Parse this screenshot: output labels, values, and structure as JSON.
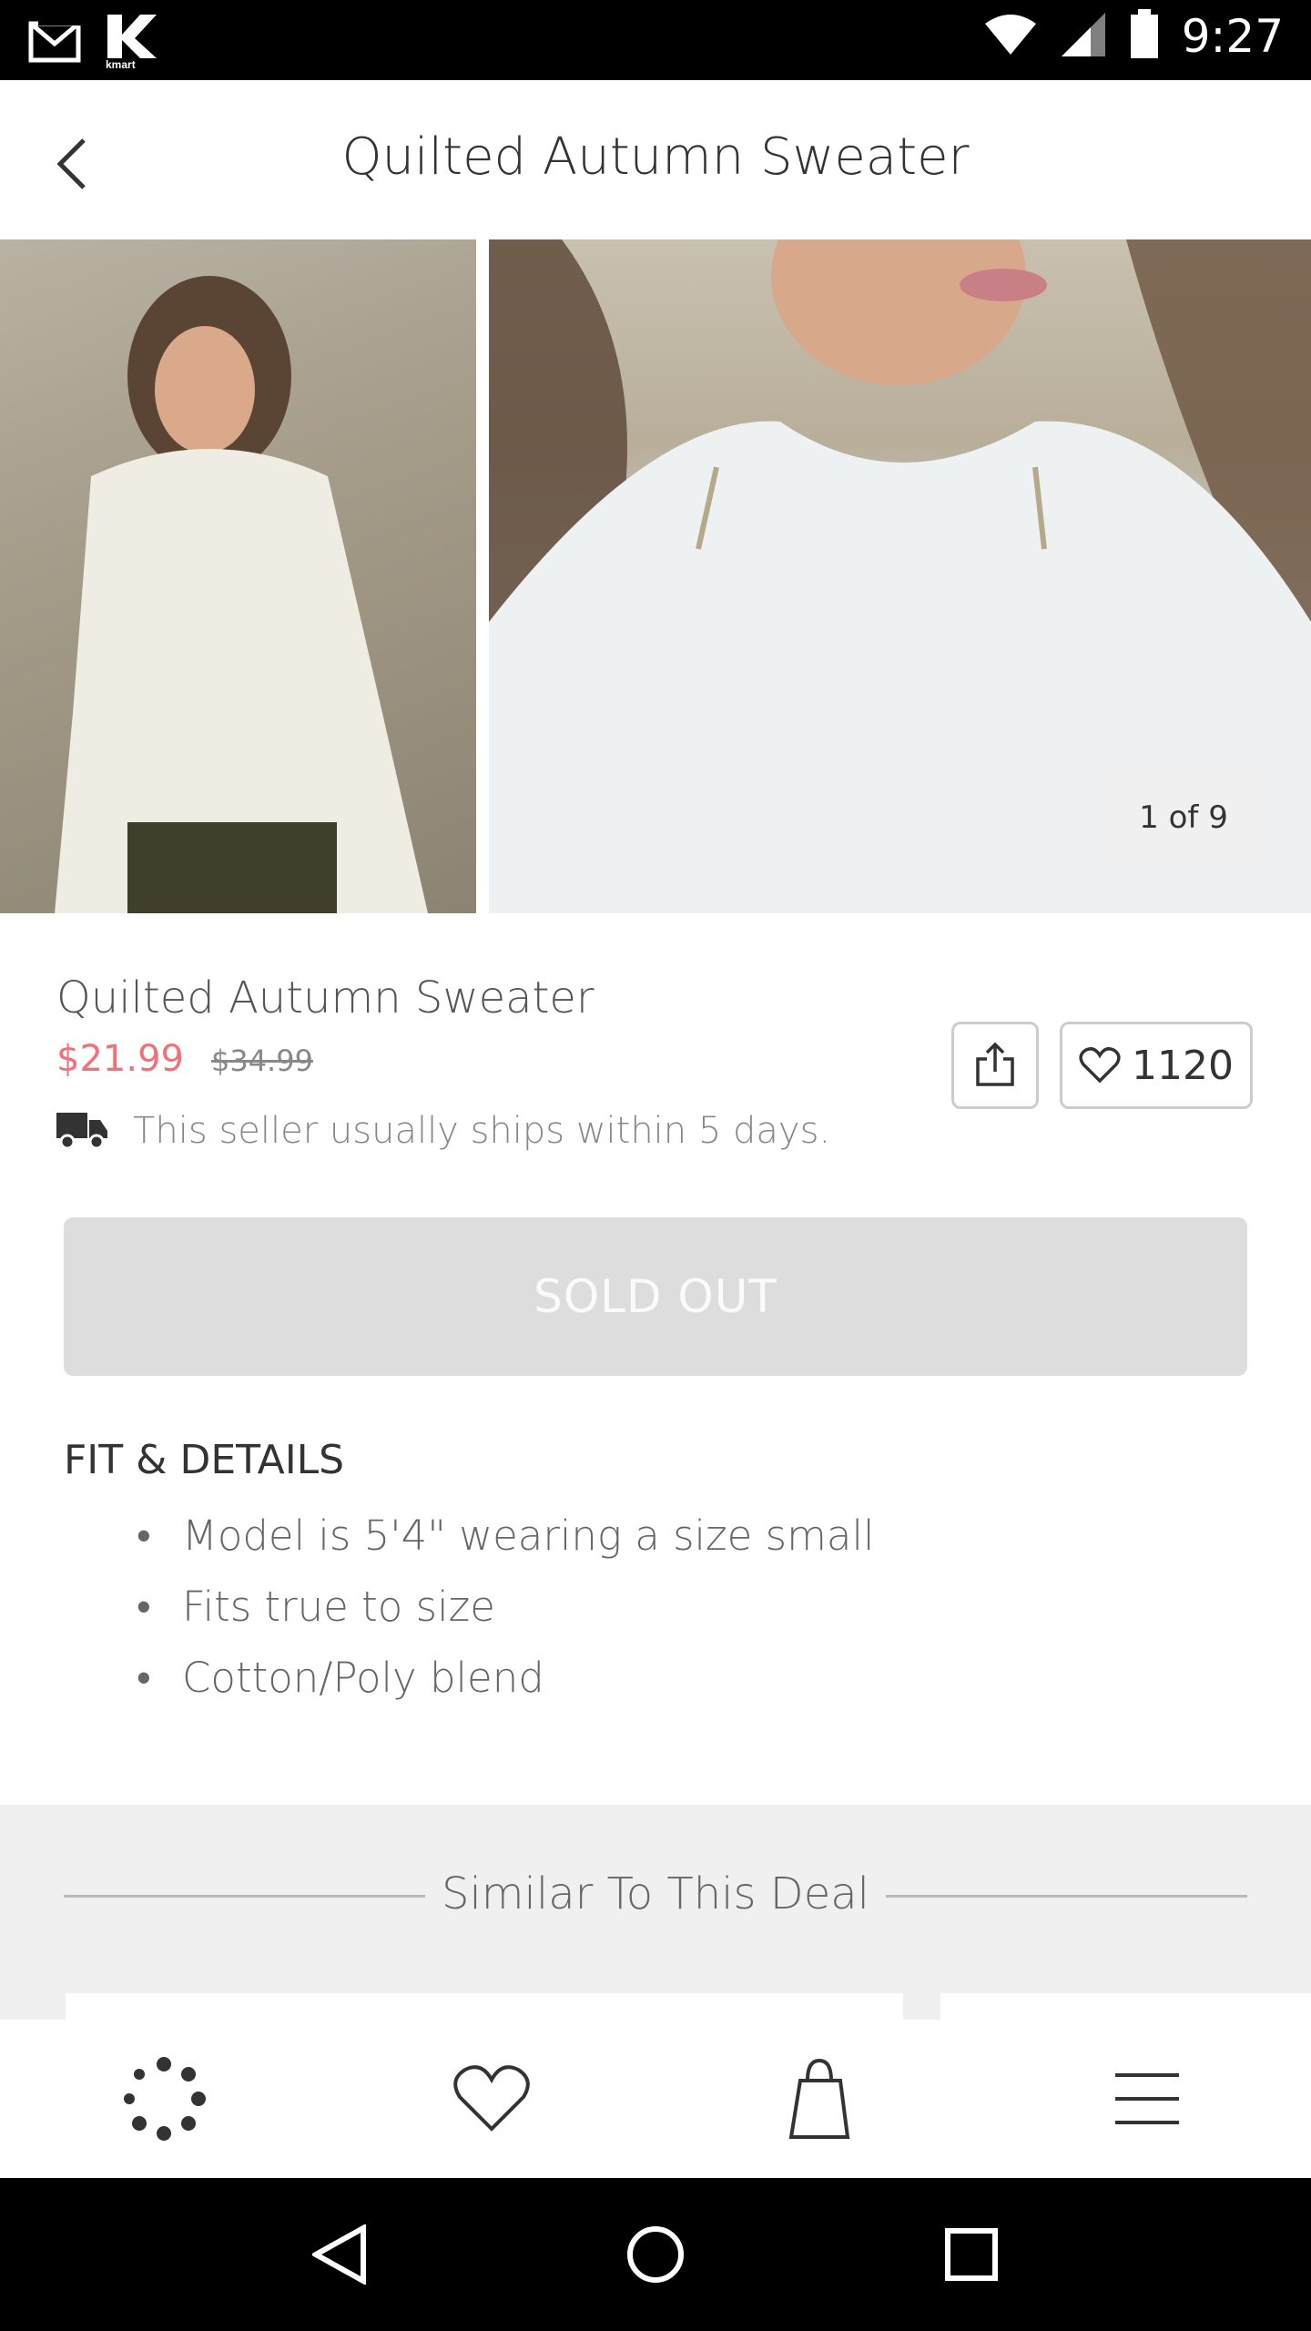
{
  "status_bar": {
    "time": "9:27",
    "left_icons": [
      "gmail-icon",
      "kmart-icon"
    ],
    "kmart_logo_text": "kmart",
    "right_icons": [
      "wifi-icon",
      "signal-icon",
      "battery-icon"
    ]
  },
  "header": {
    "title": "Quilted Autumn Sweater",
    "back_icon": "chevron-left-icon"
  },
  "gallery": {
    "pager": "1 of 9"
  },
  "product": {
    "title": "Quilted Autumn Sweater",
    "sale_price": "$21.99",
    "original_price": "$34.99",
    "shipping_text": "This seller usually ships within 5 days.",
    "favorite_count": "1120",
    "sold_out_label": "SOLD OUT"
  },
  "details": {
    "heading": "FIT & DETAILS",
    "items": [
      "Model is 5'4\" wearing a size small",
      "Fits true to size",
      "Cotton/Poly blend"
    ]
  },
  "similar": {
    "title": "Similar To This Deal"
  },
  "bottom_nav": {
    "items": [
      "deals-icon",
      "heart-icon",
      "shopping-bag-icon",
      "menu-icon"
    ]
  },
  "system_nav": {
    "items": [
      "back-triangle-icon",
      "home-circle-icon",
      "recents-square-icon"
    ]
  },
  "colors": {
    "sale_price": "#f07178",
    "sold_out_bg": "#dddddd",
    "status_bar_bg": "#000000"
  }
}
